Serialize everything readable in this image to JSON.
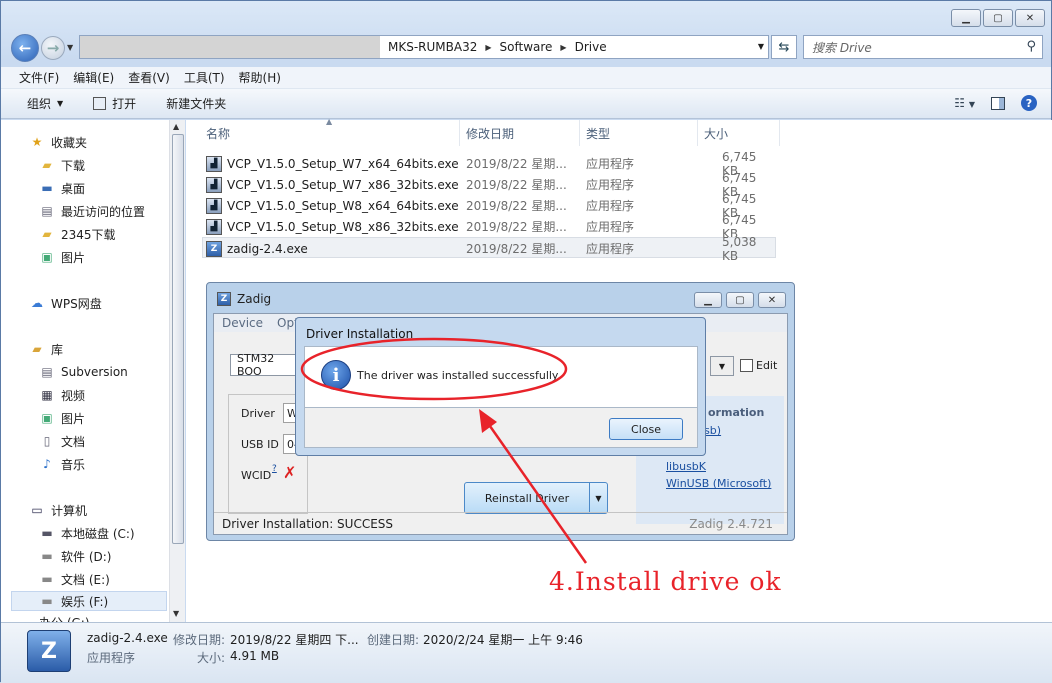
{
  "window": {
    "caption_buttons": [
      "minimize-icon",
      "maximize-icon",
      "close-icon"
    ]
  },
  "address": {
    "crumbs": [
      "MKS-RUMBA32",
      "Software",
      "Drive"
    ],
    "search_placeholder": "搜索 Drive"
  },
  "menu": [
    "文件(F)",
    "编辑(E)",
    "查看(V)",
    "工具(T)",
    "帮助(H)"
  ],
  "toolbar": {
    "organize": "组织",
    "open": "打开",
    "new_folder": "新建文件夹"
  },
  "sidebar": {
    "favorites": "收藏夹",
    "fav_items": [
      "下载",
      "桌面",
      "最近访问的位置",
      "2345下载",
      "图片"
    ],
    "wps": "WPS网盘",
    "library": "库",
    "lib_items": [
      "Subversion",
      "视频",
      "图片",
      "文档",
      "音乐"
    ],
    "computer": "计算机",
    "drives": [
      "本地磁盘 (C:)",
      "软件 (D:)",
      "文档 (E:)",
      "娱乐 (F:)",
      "办公 (G:)"
    ]
  },
  "columns": [
    "名称",
    "修改日期",
    "类型",
    "大小"
  ],
  "files": [
    {
      "name": "VCP_V1.5.0_Setup_W7_x64_64bits.exe",
      "date": "2019/8/22 星期...",
      "type": "应用程序",
      "size": "6,745 KB"
    },
    {
      "name": "VCP_V1.5.0_Setup_W7_x86_32bits.exe",
      "date": "2019/8/22 星期...",
      "type": "应用程序",
      "size": "6,745 KB"
    },
    {
      "name": "VCP_V1.5.0_Setup_W8_x64_64bits.exe",
      "date": "2019/8/22 星期...",
      "type": "应用程序",
      "size": "6,745 KB"
    },
    {
      "name": "VCP_V1.5.0_Setup_W8_x86_32bits.exe",
      "date": "2019/8/22 星期...",
      "type": "应用程序",
      "size": "6,745 KB"
    },
    {
      "name": "zadig-2.4.exe",
      "date": "2019/8/22 星期...",
      "type": "应用程序",
      "size": "5,038 KB"
    }
  ],
  "zadig": {
    "title": "Zadig",
    "menu": [
      "Device",
      "Opt"
    ],
    "device": "STM32 BOO",
    "edit_label": "Edit",
    "driver_label": "Driver",
    "driver_value": "Win",
    "usbid_label": "USB ID",
    "usbid_value": "048",
    "wcid_label": "WCID",
    "wcid_help": "?",
    "install_btn": "Reinstall Driver",
    "info_head": "ormation",
    "links": [
      "libusb)",
      "32",
      "libusbK",
      "WinUSB (Microsoft)"
    ],
    "status": "Driver Installation: SUCCESS",
    "version": "Zadig 2.4.721"
  },
  "dialog": {
    "title": "Driver Installation",
    "message": "The driver was installed successfully.",
    "close_btn": "Close"
  },
  "annotation": {
    "text": "4.Install drive ok",
    "color": "#e8232a"
  },
  "details": {
    "filename": "zadig-2.4.exe",
    "modified_label": "修改日期:",
    "modified_value": "2019/8/22 星期四 下...",
    "created_label": "创建日期:",
    "created_value": "2020/2/24 星期一 上午 9:46",
    "type": "应用程序",
    "size_label": "大小:",
    "size_value": "4.91 MB"
  }
}
